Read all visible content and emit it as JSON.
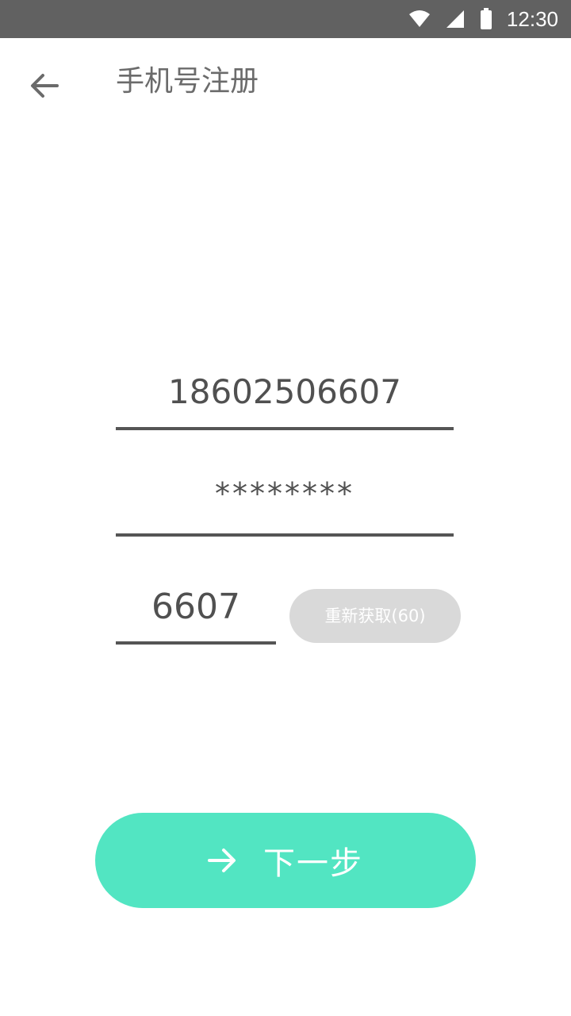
{
  "status_bar": {
    "time": "12:30",
    "icons": [
      "wifi-icon",
      "cell-signal-icon",
      "battery-icon"
    ]
  },
  "header": {
    "title": "手机号注册",
    "back_icon": "arrow-left-icon"
  },
  "form": {
    "phone": "18602506607",
    "password": "********",
    "code": "6607",
    "resend_label": "重新获取(60)"
  },
  "next_button": {
    "label": "下一步",
    "icon": "arrow-right-icon"
  },
  "colors": {
    "status_bar": "#616161",
    "accent": "#52e5c2",
    "resend_disabled": "#d9d9d9",
    "text": "#505050"
  }
}
